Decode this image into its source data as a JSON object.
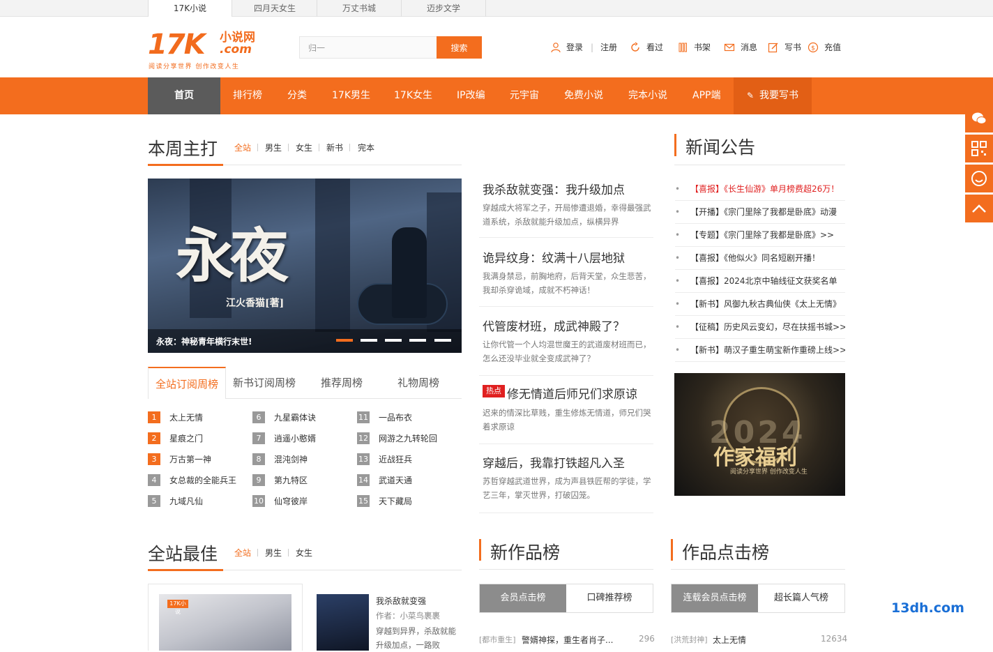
{
  "top_tabs": [
    "17K小说",
    "四月天女生",
    "万丈书城",
    "迈步文学"
  ],
  "logo": {
    "main": "17K",
    "cn": "小说网",
    "com": ".com",
    "slogan": "阅读分享世界 创作改变人生"
  },
  "search": {
    "value": "归一",
    "button": "搜索"
  },
  "user_nav": {
    "login": "登录",
    "divider": "|",
    "register": "注册",
    "history": "看过",
    "shelf": "书架",
    "message": "消息",
    "write": "写书",
    "recharge": "充值"
  },
  "nav": [
    "首页",
    "排行榜",
    "分类",
    "17K男生",
    "17K女生",
    "IP改编",
    "元宇宙",
    "免费小说",
    "完本小说",
    "APP端",
    "我要写书"
  ],
  "weekly": {
    "title": "本周主打",
    "filters": [
      "全站",
      "男生",
      "女生",
      "新书",
      "完本"
    ],
    "banner": {
      "big_title": "永夜",
      "author": "江火香猫[著]",
      "caption": "永夜：神秘青年横行末世!"
    },
    "stories": [
      {
        "title": "我杀敌就变强：我升级加点",
        "desc": "穿越成大将军之子，开局惨遭退婚，幸得最强武道系统，杀敌就能升级加点，纵横异界"
      },
      {
        "title": "诡异纹身：纹满十八层地狱",
        "desc": "我满身禁忌，前胸地府，后背天堂，众生悲苦，我却杀穿诡域，成就不朽神话！"
      },
      {
        "title": "代管废材班，成武神殿了？",
        "desc": "让你代管一个人均混世魔王的武道废材班而已，怎么还没毕业就全变成武神了？"
      },
      {
        "title": "修无情道后师兄们求原谅",
        "tag": "热点",
        "desc": "迟来的情深比草贱，重生修炼无情道，师兄们哭着求原谅"
      },
      {
        "title": "穿越后，我靠打铁超凡入圣",
        "desc": "苏哲穿越武道世界，成为声县铁匠帮的学徒，学艺三年，掌灭世界，打破囚笼。"
      }
    ]
  },
  "rank_tabs": [
    "全站订阅周榜",
    "新书订阅周榜",
    "推荐周榜",
    "礼物周榜"
  ],
  "rank_list": [
    [
      "1",
      "太上无情"
    ],
    [
      "2",
      "星痕之门"
    ],
    [
      "3",
      "万古第一神"
    ],
    [
      "4",
      "女总裁的全能兵王"
    ],
    [
      "5",
      "九域凡仙"
    ],
    [
      "6",
      "九星霸体诀"
    ],
    [
      "7",
      "逍遥小憨婿"
    ],
    [
      "8",
      "混沌剑神"
    ],
    [
      "9",
      "第九特区"
    ],
    [
      "10",
      "仙穹彼岸"
    ],
    [
      "11",
      "一品布衣"
    ],
    [
      "12",
      "网游之九转轮回"
    ],
    [
      "13",
      "近战狂兵"
    ],
    [
      "14",
      "武道天通"
    ],
    [
      "15",
      "天下藏局"
    ]
  ],
  "news": {
    "title": "新闻公告",
    "items": [
      "【喜报】《长生仙游》单月榜费超26万！",
      "【开播】《宗门里除了我都是卧底》动漫",
      "【专题】《宗门里除了我都是卧底》>>",
      "【喜报】《他似火》同名短剧开播！",
      "【喜报】2024北京中轴线征文获奖名单",
      "【新书】风御九秋古典仙侠《太上无情》",
      "【征稿】历史风云变幻，尽在扶摇书城>>",
      "【新书】萌汉子重生萌宝新作重磅上线>>"
    ],
    "poster": {
      "title": "作家福利",
      "year": "2024",
      "sub": "阅读分享世界 创作改变人生"
    }
  },
  "best": {
    "title": "全站最佳",
    "filters": [
      "全站",
      "男生",
      "女生"
    ],
    "book": {
      "cover_logo": "17K小说",
      "title": "我杀敌就变强",
      "author": "作者：小菜鸟裹裹",
      "desc": "穿越到异界，杀敌就能升级加点，一路败"
    }
  },
  "new_rank": {
    "title": "新作品榜",
    "tabs": [
      "会员点击榜",
      "口碑推荐榜"
    ],
    "row": {
      "cat": "[都市重生]",
      "name": "警婿神探，重生者肖子...",
      "value": "296"
    }
  },
  "click_rank": {
    "title": "作品点击榜",
    "tabs": [
      "连载会员点击榜",
      "超长篇人气榜"
    ],
    "row": {
      "cat": "[洪荒封神]",
      "name": "太上无情",
      "value": "12634"
    }
  },
  "watermark": "13dh.com",
  "colors": {
    "accent": "#f36d1e",
    "nav_home": "#5b5b5b",
    "hot": "#e02020"
  }
}
